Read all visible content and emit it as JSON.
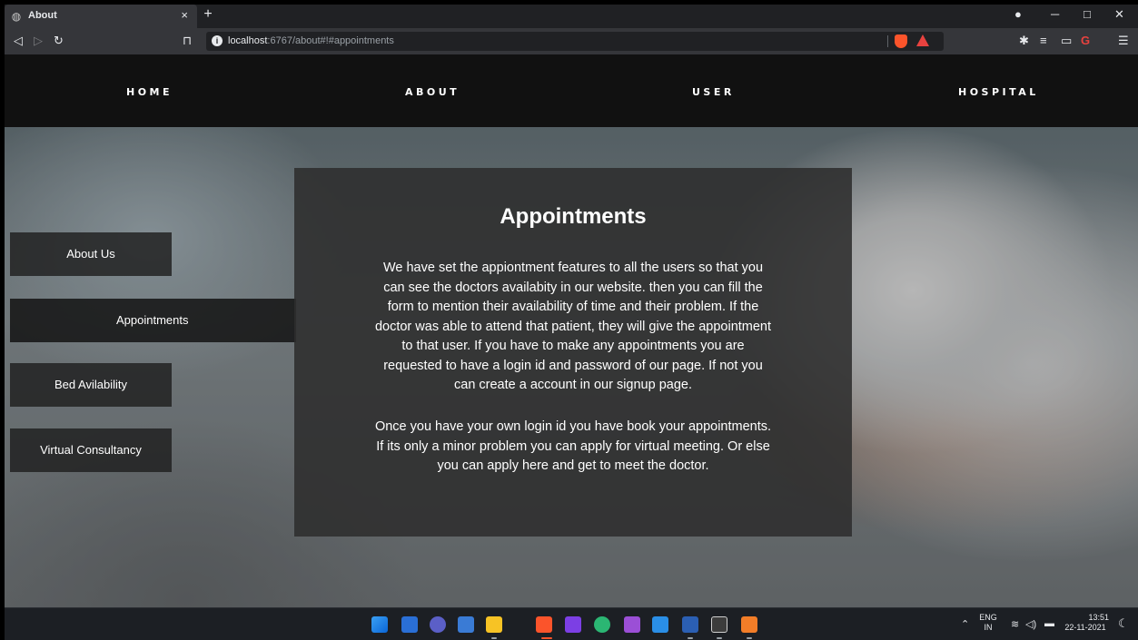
{
  "browser": {
    "tab_title": "About",
    "tab_close": "×",
    "new_tab": "+",
    "url_host": "localhost",
    "url_rest": ":6767/about#!#appointments",
    "window_controls": [
      "─",
      "□",
      "✕"
    ]
  },
  "nav": {
    "items": [
      "HOME",
      "ABOUT",
      "USER",
      "HOSPITAL"
    ]
  },
  "sidebar": {
    "items": [
      "About Us",
      "Appointments",
      "Bed Avilability",
      "Virtual Consultancy"
    ],
    "active_index": 1
  },
  "content": {
    "title": "Appointments",
    "para1_lines": [
      "We have set the appiontment features to all the users so that you",
      "can see the doctors availabity in our website. then you can fill the",
      "form to mention their availability of time and their problem. If the",
      "doctor was able to attend that patient, they will give the appointment",
      "to that user. If you have to make any appointments you are",
      "requested to have a login id and password of our page. If not you",
      "can create a account in our signup page."
    ],
    "para2_lines": [
      "Once you have your own login id you have book your appointments.",
      "If its only a minor problem you can apply for virtual meeting. Or else",
      "you can apply here and get to meet the doctor."
    ]
  },
  "taskbar": {
    "lang_top": "ENG",
    "lang_bottom": "IN",
    "time": "13:51",
    "date": "22-11-2021"
  },
  "colors": {
    "nav_bg": "#111111",
    "content_bg": "#2d2d2d",
    "taskbar_bg": "#1c1f24"
  }
}
